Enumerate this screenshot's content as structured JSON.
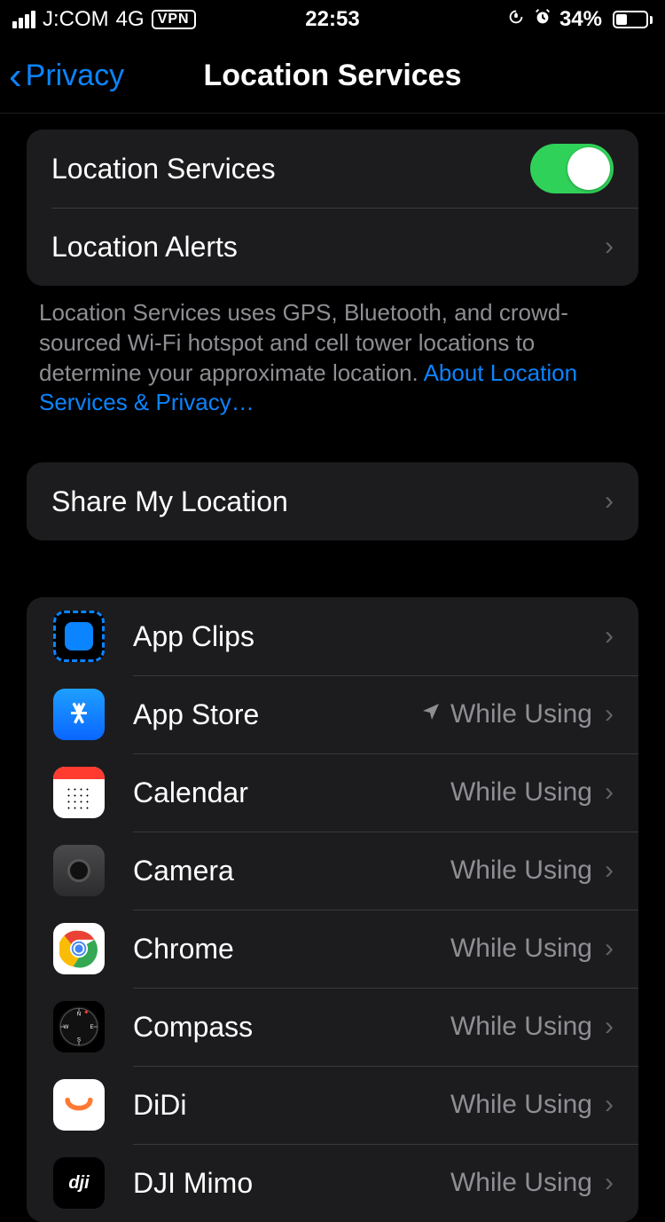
{
  "status": {
    "carrier": "J:COM",
    "network": "4G",
    "vpn": "VPN",
    "time": "22:53",
    "battery_pct": "34%"
  },
  "nav": {
    "back_label": "Privacy",
    "title": "Location Services"
  },
  "main_toggle": {
    "label": "Location Services",
    "on": true
  },
  "location_alerts": {
    "label": "Location Alerts"
  },
  "footer": {
    "text": "Location Services uses GPS, Bluetooth, and crowd-sourced Wi-Fi hotspot and cell tower locations to determine your approximate location. ",
    "link": "About Location Services & Privacy…"
  },
  "share": {
    "label": "Share My Location"
  },
  "apps": [
    {
      "name": "App Clips",
      "status": "",
      "arrow": false,
      "icon": "appclips"
    },
    {
      "name": "App Store",
      "status": "While Using",
      "arrow": true,
      "icon": "appstore"
    },
    {
      "name": "Calendar",
      "status": "While Using",
      "arrow": false,
      "icon": "calendar"
    },
    {
      "name": "Camera",
      "status": "While Using",
      "arrow": false,
      "icon": "camera"
    },
    {
      "name": "Chrome",
      "status": "While Using",
      "arrow": false,
      "icon": "chrome"
    },
    {
      "name": "Compass",
      "status": "While Using",
      "arrow": false,
      "icon": "compass"
    },
    {
      "name": "DiDi",
      "status": "While Using",
      "arrow": false,
      "icon": "didi"
    },
    {
      "name": "DJI Mimo",
      "status": "While Using",
      "arrow": false,
      "icon": "dji"
    }
  ]
}
